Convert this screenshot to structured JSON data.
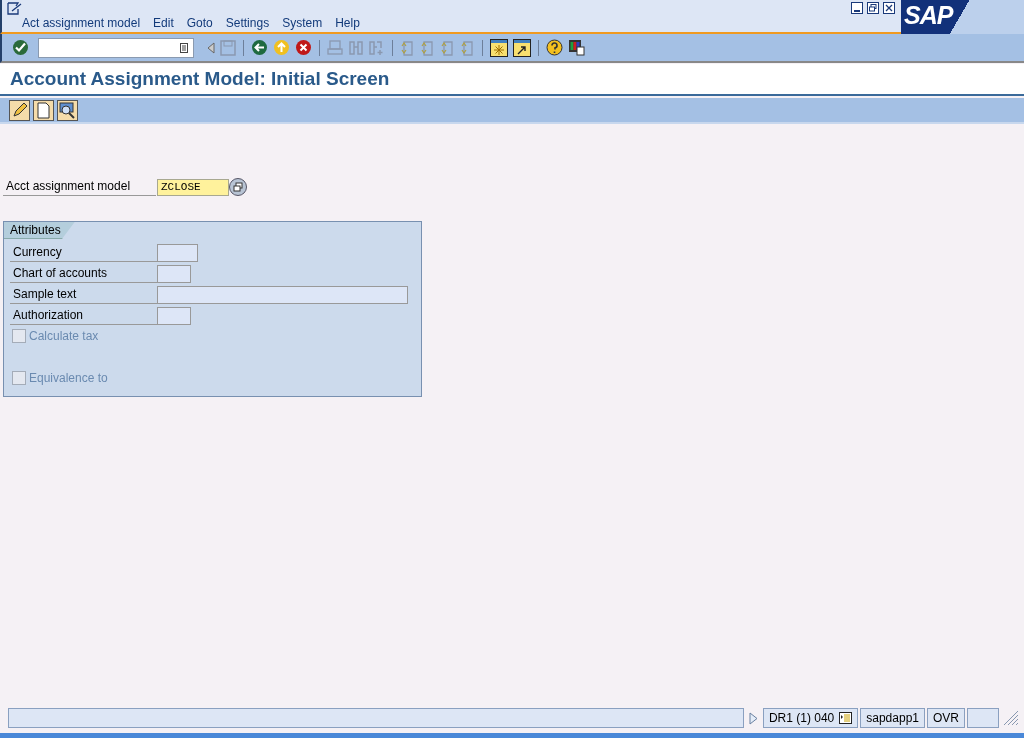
{
  "menu": [
    "Act assignment model",
    "Edit",
    "Goto",
    "Settings",
    "System",
    "Help"
  ],
  "logo": "SAP",
  "title": "Account Assignment Model: Initial Screen",
  "model_field": {
    "label": "Acct assignment model",
    "value": "ZCLOSE"
  },
  "attributes": {
    "title": "Attributes",
    "fields": [
      {
        "kind": "text",
        "label": "Currency"
      },
      {
        "kind": "text",
        "label": "Chart of accounts"
      },
      {
        "kind": "text",
        "label": "Sample text"
      },
      {
        "kind": "text",
        "label": "Authorization"
      },
      {
        "kind": "checkbox",
        "label": "Calculate tax",
        "checked": false,
        "disabled": true
      },
      {
        "kind": "gap"
      },
      {
        "kind": "checkbox",
        "label": "Equivalence to",
        "checked": false,
        "disabled": true
      }
    ]
  },
  "status_bar": {
    "system": "DR1 (1) 040",
    "server": "sapdapp1",
    "mode": "OVR"
  }
}
